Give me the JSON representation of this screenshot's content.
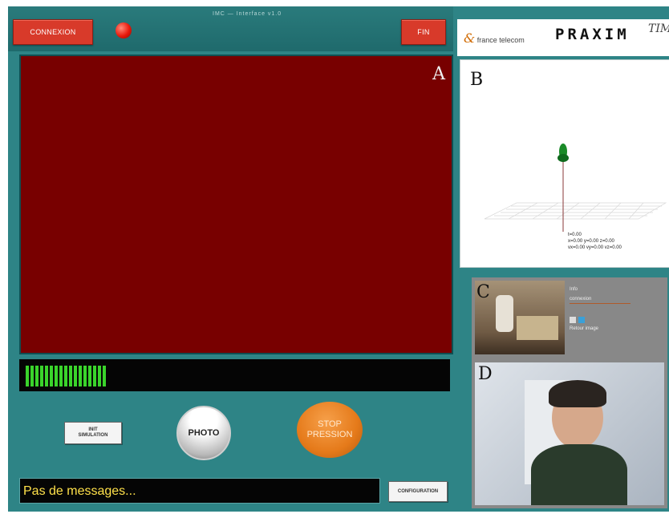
{
  "header": {
    "connect_button": "CONNEXION",
    "end_button": "FIN",
    "title": "IMC — Interface v1.0"
  },
  "panels": {
    "a": "A",
    "b": "B",
    "c": "C",
    "d": "D"
  },
  "level_meter": {
    "segments": 17
  },
  "controls": {
    "init_simulation_line1": "INIT",
    "init_simulation_line2": "SIMULATION",
    "photo_button": "PHOTO",
    "stop_line1": "STOP",
    "stop_line2": "PRESSION"
  },
  "message_bar": {
    "text": "Pas de messages..."
  },
  "configuration_button": "CONFIGURATION",
  "logos": {
    "france_telecom": "france telecom",
    "praxim": "PRAXIM",
    "timc": "TIMC"
  },
  "readout": {
    "line1": "t=0.00",
    "line2": "x=0.00 y=0.00 z=0.00",
    "line3": "vx=0.00 vy=0.00 vz=0.00"
  },
  "panel_c_info": {
    "label1": "Info",
    "label2": "connexion",
    "label3": "Retour image"
  },
  "colors": {
    "panel_a_bg": "#780000",
    "app_bg": "#2e8486",
    "led_red": "#e8190b",
    "meter_green": "#3ad42b",
    "stop_orange": "#e57a1a",
    "message_yellow": "#ffe14a"
  },
  "icons": {
    "status_led": "red-status-led",
    "photo": "camera-button",
    "stop": "stop-pressure-button"
  }
}
